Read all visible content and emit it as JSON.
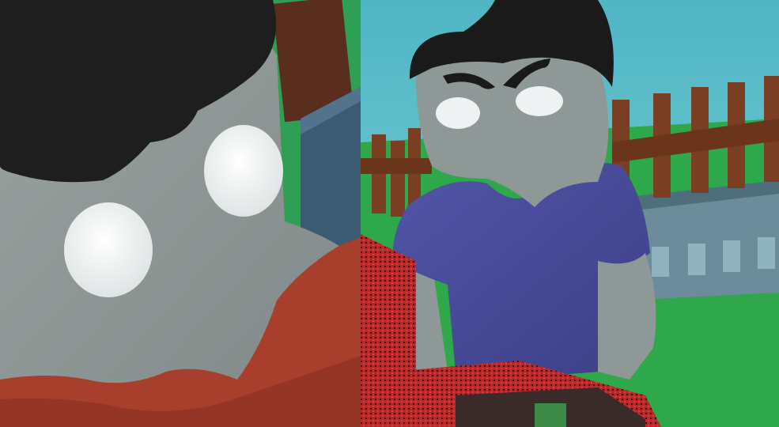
{
  "scene": {
    "layout": "two-panel-render",
    "left_panel": {
      "subject": "character-face-closeup",
      "colors": {
        "sky": "#2f9f55",
        "wall": "#3c5b73",
        "fence": "#5a2e1e",
        "skin": "#8e9896",
        "hair": "#1e1e1e",
        "eyes": "#f2f4f4",
        "scarf": "#a83e2c"
      }
    },
    "right_panel": {
      "subject": "character-holding-box",
      "colors": {
        "sky": "#58c2cc",
        "grass": "#2ea84a",
        "fence": "#7a3e22",
        "wall": "#6c8c9c",
        "skin": "#8e9896",
        "hair": "#1a1a1a",
        "eyes": "#eef2f2",
        "shirt": "#4a4d9a",
        "box": "#b82828"
      }
    }
  }
}
